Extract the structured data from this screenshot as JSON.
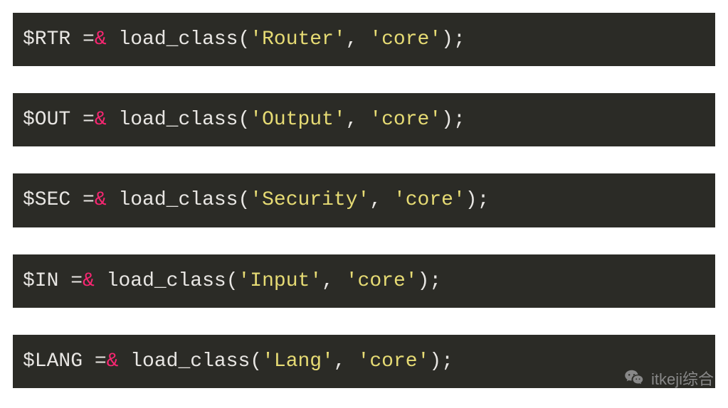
{
  "snippets": [
    {
      "varName": "$RTR",
      "func": "load_class",
      "arg1": "'Router'",
      "arg2": "'core'"
    },
    {
      "varName": "$OUT",
      "func": "load_class",
      "arg1": "'Output'",
      "arg2": "'core'"
    },
    {
      "varName": "$SEC",
      "func": "load_class",
      "arg1": "'Security'",
      "arg2": "'core'"
    },
    {
      "varName": "$IN",
      "func": "load_class",
      "arg1": "'Input'",
      "arg2": "'core'"
    },
    {
      "varName": "$LANG",
      "func": "load_class",
      "arg1": "'Lang'",
      "arg2": "'core'"
    }
  ],
  "watermark": {
    "label": "itkeji综合"
  }
}
